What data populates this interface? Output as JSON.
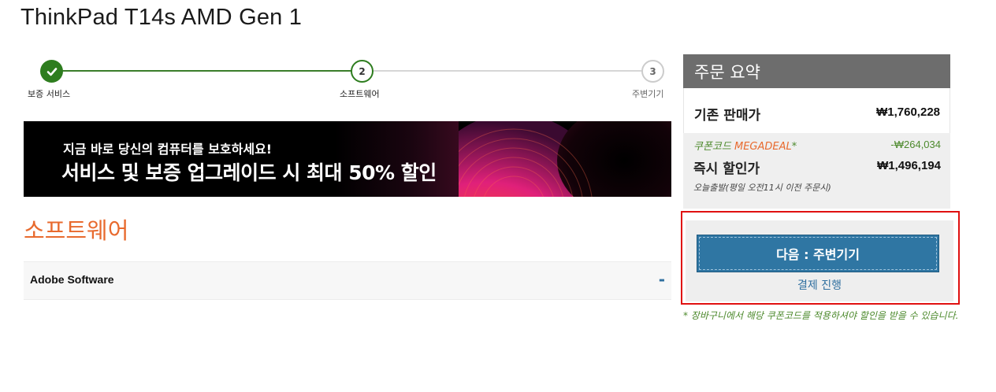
{
  "product": {
    "title": "ThinkPad T14s AMD Gen 1"
  },
  "steps": [
    {
      "number": "1",
      "label": "보증 서비스",
      "state": "done"
    },
    {
      "number": "2",
      "label": "소프트웨어",
      "state": "current"
    },
    {
      "number": "3",
      "label": "주변기기",
      "state": "todo"
    }
  ],
  "banner": {
    "line1": "지금 바로 당신의 컴퓨터를 보호하세요!",
    "line2": "서비스 및 보증 업그레이드 시 최대 50% 할인"
  },
  "section": {
    "title": "소프트웨어"
  },
  "accordion": {
    "title": "Adobe Software",
    "toggle": "-"
  },
  "summary": {
    "header": "주문 요약",
    "original_label": "기존 판매가",
    "original_value": "₩1,760,228",
    "coupon_prefix": "쿠폰코드 ",
    "coupon_code": "MEGADEAL",
    "coupon_suffix": "*",
    "coupon_value": "-₩264,034",
    "instant_label": "즉시 할인가",
    "instant_value": "₩1,496,194",
    "delivery_note": "오늘출발(평일 오전11시 이전 주문시)"
  },
  "actions": {
    "next_label": "다음 : 주변기기",
    "checkout_label": "결제 진행"
  },
  "notice": "* 장바구니에서 해당 쿠폰코드를 적용하셔야 할인을 받을 수 있습니다.",
  "colors": {
    "accent_blue": "#2f76a3",
    "step_green": "#2e7d1f",
    "orange": "#e86a2e",
    "coupon_green": "#4d8a2d",
    "highlight_red": "#e01010"
  }
}
